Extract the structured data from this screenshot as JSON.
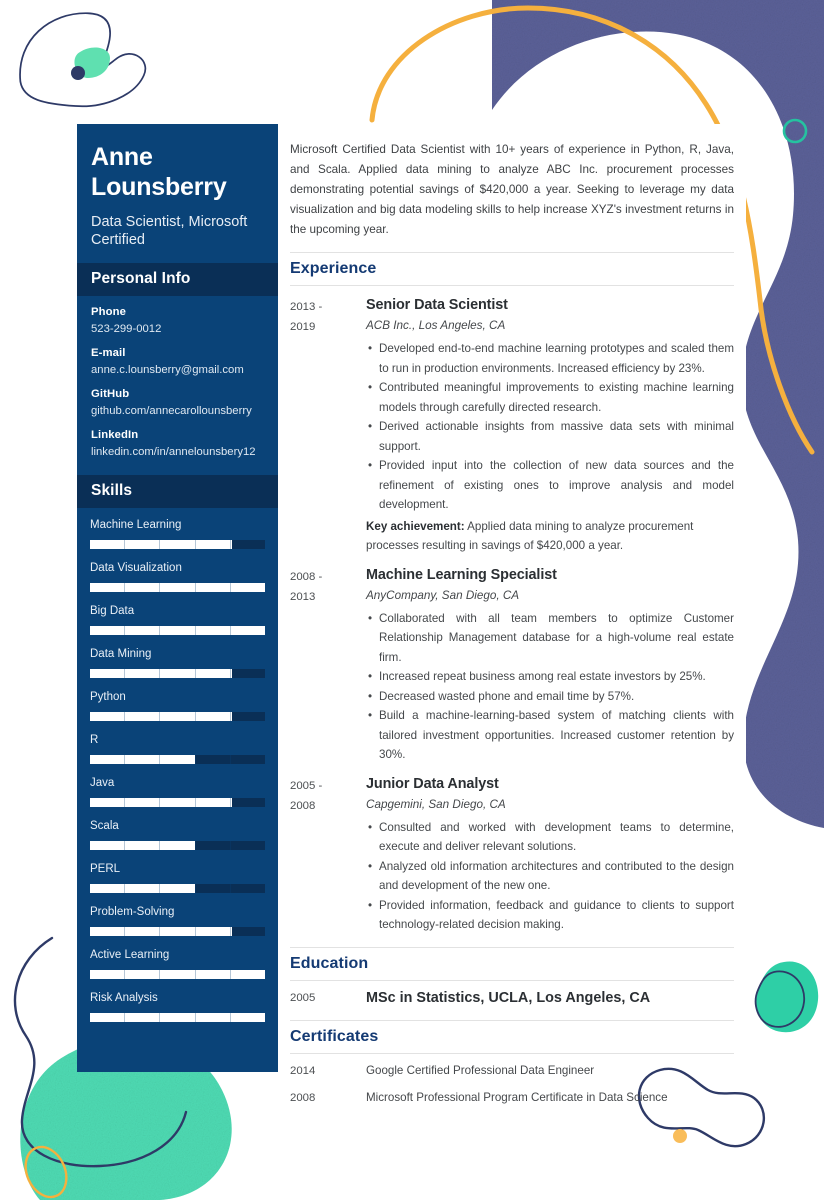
{
  "colors": {
    "sidebar_bg": "#0a4378",
    "sidebar_head_bg": "#0a2f56",
    "heading_blue": "#143a73",
    "accent_navy": "#2e3a67",
    "accent_green": "#45d6ac",
    "accent_orange": "#f5b03e",
    "accent_teal": "#25c2a0",
    "text_body": "#45484b",
    "rule": "#e2e2e2"
  },
  "sidebar": {
    "name": "Anne Lounsberry",
    "name_line1": "Anne",
    "name_line2": "Lounsberry",
    "job_title": "Data Scientist, Microsoft Certified",
    "personal_info_heading": "Personal Info",
    "contacts": [
      {
        "label": "Phone",
        "value": "523-299-0012"
      },
      {
        "label": "E-mail",
        "value": "anne.c.lounsberry@gmail.com"
      },
      {
        "label": "GitHub",
        "value": "github.com/annecarollounsberry"
      },
      {
        "label": "LinkedIn",
        "value": "linkedin.com/in/annelounsbery12"
      }
    ],
    "skills_heading": "Skills",
    "skills": [
      {
        "name": "Machine Learning",
        "level": 81
      },
      {
        "name": "Data Visualization",
        "level": 100
      },
      {
        "name": "Big Data",
        "level": 100
      },
      {
        "name": "Data Mining",
        "level": 81
      },
      {
        "name": "Python",
        "level": 81
      },
      {
        "name": "R",
        "level": 60
      },
      {
        "name": "Java",
        "level": 81
      },
      {
        "name": "Scala",
        "level": 60
      },
      {
        "name": "PERL",
        "level": 60
      },
      {
        "name": "Problem-Solving",
        "level": 81
      },
      {
        "name": "Active Learning",
        "level": 100
      },
      {
        "name": "Risk Analysis",
        "level": 100
      }
    ]
  },
  "main": {
    "summary": "Microsoft Certified Data Scientist with 10+ years of experience in Python, R, Java, and Scala. Applied data mining to analyze ABC Inc. procurement processes demonstrating potential savings of $420,000 a year. Seeking to leverage my data visualization and big data modeling skills to help increase XYZ's investment returns in the upcoming year.",
    "experience_heading": "Experience",
    "experience": [
      {
        "dates_line1": "2013 -",
        "dates_line2": "2019",
        "role": "Senior Data Scientist",
        "company": "ACB Inc., Los Angeles, CA",
        "bullets": [
          "Developed end-to-end machine learning prototypes and scaled them to run in production environments. Increased efficiency by 23%.",
          "Contributed meaningful improvements to existing machine learning models through carefully directed research.",
          "Derived actionable insights from massive data sets with minimal support.",
          "Provided input into the collection of new data sources and the refinement of existing ones to improve analysis and model development."
        ],
        "key_achievement_label": "Key achievement:",
        "key_achievement_text": " Applied data mining to analyze procurement processes resulting in savings of $420,000 a year."
      },
      {
        "dates_line1": "2008 -",
        "dates_line2": "2013",
        "role": "Machine Learning Specialist",
        "company": "AnyCompany,  San Diego, CA",
        "bullets": [
          "Collaborated with all team members to optimize Customer Relationship Management database for a high-volume real estate firm.",
          "Increased repeat business among real estate investors by 25%.",
          "Decreased wasted phone and email time by 57%.",
          "Build a machine-learning-based system of matching clients with tailored investment opportunities. Increased customer retention by 30%."
        ],
        "key_achievement_label": "",
        "key_achievement_text": ""
      },
      {
        "dates_line1": "2005 -",
        "dates_line2": "2008",
        "role": "Junior Data Analyst",
        "company": "Capgemini, San Diego, CA",
        "bullets": [
          "Consulted and worked with development teams to determine, execute and deliver relevant solutions.",
          "Analyzed old information architectures and contributed to the design and development of the new one.",
          "Provided information, feedback and guidance to clients to support technology-related decision making."
        ],
        "key_achievement_label": "",
        "key_achievement_text": ""
      }
    ],
    "education_heading": "Education",
    "education": [
      {
        "year": "2005",
        "text": "MSc in Statistics, UCLA, Los Angeles, CA"
      }
    ],
    "certificates_heading": "Certificates",
    "certificates": [
      {
        "year": "2014",
        "text": "Google Certified Professional Data Engineer"
      },
      {
        "year": "2008",
        "text": "Microsoft Professional Program Certificate in Data Science"
      }
    ]
  }
}
